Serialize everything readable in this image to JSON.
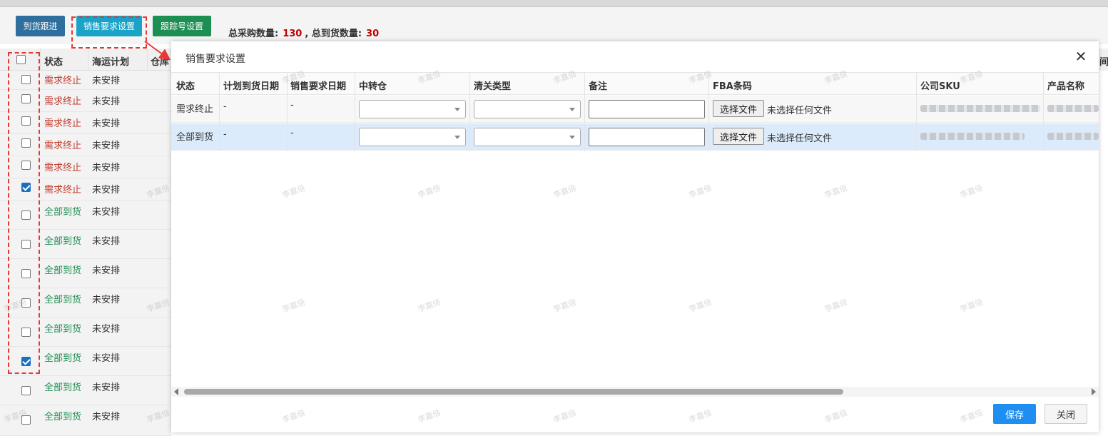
{
  "toolbar": {
    "btn_arrival": "到货跟进",
    "btn_sales": "销售要求设置",
    "btn_track": "跟踪号设置",
    "label_purchase": "总采购数量:",
    "purchase_count": "130",
    "sep": ",",
    "label_arrived": "总到货数量:",
    "arrived_count": "30"
  },
  "bg_table": {
    "headers": {
      "status": "状态",
      "plan": "海运计划",
      "warehouse": "仓库"
    },
    "right_edge_head": "间",
    "rows": [
      {
        "status": "需求终止",
        "plan": "未安排",
        "checked": false
      },
      {
        "status": "需求终止",
        "plan": "未安排",
        "checked": false
      },
      {
        "status": "需求终止",
        "plan": "未安排",
        "checked": false
      },
      {
        "status": "需求终止",
        "plan": "未安排",
        "checked": false
      },
      {
        "status": "需求终止",
        "plan": "未安排",
        "checked": false
      },
      {
        "status": "需求终止",
        "plan": "未安排",
        "checked": true
      },
      {
        "status": "全部到货",
        "plan": "未安排",
        "checked": false
      },
      {
        "status": "全部到货",
        "plan": "未安排",
        "checked": false
      },
      {
        "status": "全部到货",
        "plan": "未安排",
        "checked": false
      },
      {
        "status": "全部到货",
        "plan": "未安排",
        "checked": false
      },
      {
        "status": "全部到货",
        "plan": "未安排",
        "checked": false
      },
      {
        "status": "全部到货",
        "plan": "未安排",
        "checked": true
      },
      {
        "status": "全部到货",
        "plan": "未安排",
        "checked": false
      },
      {
        "status": "全部到货",
        "plan": "未安排",
        "checked": false
      }
    ]
  },
  "modal": {
    "title": "销售要求设置",
    "close_glyph": "✕",
    "columns": {
      "status": "状态",
      "planned_date": "计划到货日期",
      "sales_date": "销售要求日期",
      "transit": "中转仓",
      "customs": "清关类型",
      "remark": "备注",
      "fba": "FBA条码",
      "sku": "公司SKU",
      "product": "产品名称"
    },
    "rows": [
      {
        "status": "需求终止",
        "planned_date": "-",
        "sales_date": "-",
        "file_button": "选择文件",
        "file_status": "未选择任何文件"
      },
      {
        "status": "全部到货",
        "planned_date": "-",
        "sales_date": "-",
        "file_button": "选择文件",
        "file_status": "未选择任何文件"
      }
    ],
    "save_label": "保存",
    "close_label": "关闭"
  },
  "watermark": "李嘉倍",
  "colors": {
    "stop_status": "#c0392b",
    "done_status": "#1e8f53",
    "primary": "#1e8ff0",
    "annotation": "#e53935"
  }
}
